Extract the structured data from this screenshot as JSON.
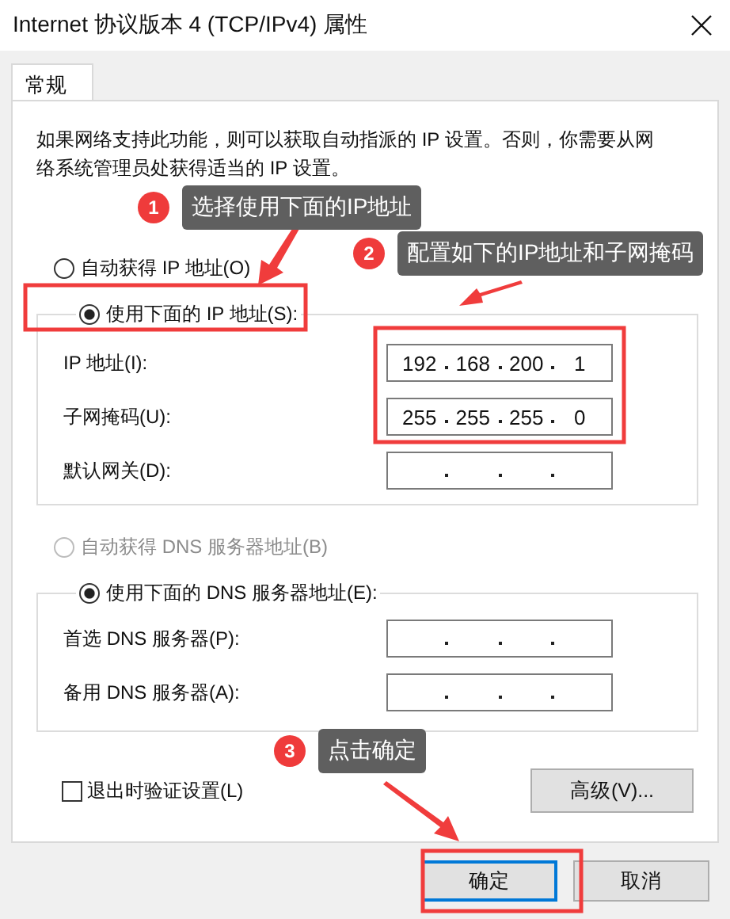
{
  "window": {
    "title": "Internet 协议版本 4 (TCP/IPv4) 属性"
  },
  "tabs": [
    {
      "label": "常规",
      "selected": true
    }
  ],
  "description": "如果网络支持此功能，则可以获取自动指派的 IP 设置。否则，你需要从网络系统管理员处获得适当的 IP 设置。",
  "ip_mode": [
    {
      "label": "自动获得 IP 地址(O)",
      "selected": false,
      "disabled": false
    },
    {
      "label": "使用下面的 IP 地址(S):",
      "selected": true,
      "disabled": false
    }
  ],
  "ip_fields": [
    {
      "label": "IP 地址(I):",
      "octets": [
        "192",
        "168",
        "200",
        "1"
      ]
    },
    {
      "label": "子网掩码(U):",
      "octets": [
        "255",
        "255",
        "255",
        "0"
      ]
    },
    {
      "label": "默认网关(D):"
    }
  ],
  "dns_mode": [
    {
      "label": "自动获得 DNS 服务器地址(B)",
      "selected": false,
      "disabled": true
    },
    {
      "label": "使用下面的 DNS 服务器地址(E):",
      "selected": true,
      "disabled": false
    }
  ],
  "dns_fields": [
    {
      "label": "首选 DNS 服务器(P):"
    },
    {
      "label": "备用 DNS 服务器(A):"
    }
  ],
  "validate": {
    "label": "退出时验证设置(L)",
    "checked": false
  },
  "advanced_button": "高级(V)...",
  "buttons": [
    {
      "label": "确定",
      "default": true
    },
    {
      "label": "取消",
      "default": false
    }
  ],
  "annotations": [
    {
      "number": "1",
      "text": "选择使用下面的IP地址"
    },
    {
      "number": "2",
      "text": "配置如下的IP地址和子网掩码"
    },
    {
      "number": "3",
      "text": "点击确定"
    }
  ]
}
